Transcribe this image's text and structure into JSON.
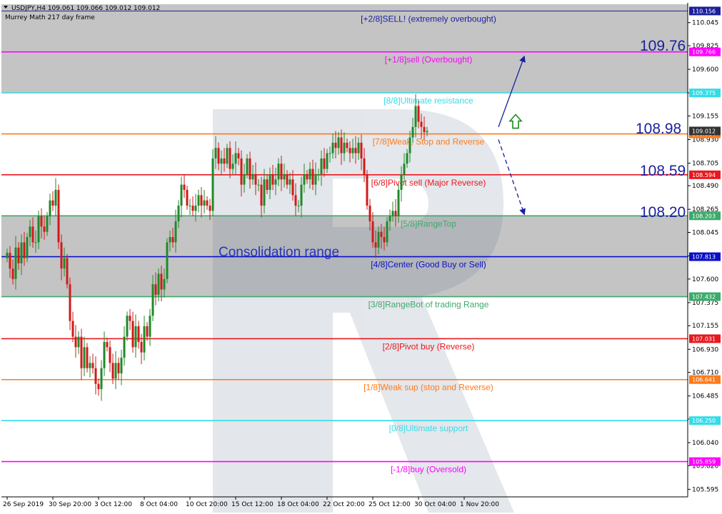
{
  "header": {
    "symbol_line": "USDJPY,H4  109.061 109.066 109.012 109.012",
    "subtitle": "Murrey Math 217 day frame"
  },
  "colors": {
    "magenta": "#ff00ff",
    "cyan": "#33dde8",
    "orange": "#ff7a1a",
    "red": "#e8181f",
    "green": "#3caa6b",
    "blue": "#0a10c8",
    "navy": "#1a1f9c",
    "zone": "#c4c4c4",
    "bull": "#1f8a2a",
    "bear": "#d11a1a",
    "arrow_green": "#1a8a1a"
  },
  "annotations": {
    "consolidation": "Consolidation range",
    "big_labels": [
      "109.76",
      "108.98",
      "108.59",
      "108.20"
    ]
  },
  "chart_data": {
    "type": "candlestick",
    "symbol": "USDJPY",
    "timeframe": "H4",
    "ylim": [
      105.55,
      110.22
    ],
    "y_ticks": [
      110.045,
      109.825,
      109.6,
      109.375,
      109.155,
      108.93,
      108.705,
      108.49,
      108.265,
      108.045,
      107.82,
      107.6,
      107.375,
      107.155,
      106.93,
      106.71,
      106.485,
      106.265,
      106.04,
      105.82,
      105.595
    ],
    "x_ticks": [
      {
        "label": "26 Sep 2019",
        "i": 0
      },
      {
        "label": "30 Sep 20:00",
        "i": 16
      },
      {
        "label": "3 Oct 12:00",
        "i": 32
      },
      {
        "label": "8 Oct 04:00",
        "i": 48
      },
      {
        "label": "10 Oct 20:00",
        "i": 64
      },
      {
        "label": "15 Oct 12:00",
        "i": 80
      },
      {
        "label": "18 Oct 04:00",
        "i": 96
      },
      {
        "label": "22 Oct 20:00",
        "i": 112
      },
      {
        "label": "25 Oct 12:00",
        "i": 128
      },
      {
        "label": "30 Oct 04:00",
        "i": 144
      },
      {
        "label": "1 Nov 20:00",
        "i": 160
      }
    ],
    "levels": [
      {
        "price": 110.156,
        "label": "[+2/8]SELL! (extremely overbought)",
        "tag": "110.156",
        "color": "navy"
      },
      {
        "price": 109.766,
        "label": "[+1/8]sell (Overbought)",
        "tag": "109.766",
        "color": "magenta"
      },
      {
        "price": 109.375,
        "label": "[8/8]Ultimate resistance",
        "tag": "109.375",
        "color": "cyan"
      },
      {
        "price": 108.984,
        "label": "[7/8]Weak, Stop and Reverse",
        "tag": "108.984",
        "color": "orange"
      },
      {
        "price": 108.594,
        "label": "[6/8]Pivot sell (Major Reverse)",
        "tag": "108.594",
        "color": "red"
      },
      {
        "price": 108.203,
        "label": "[5/8]RangeTop",
        "tag": "108.203",
        "color": "green"
      },
      {
        "price": 107.813,
        "label": "[4/8]Center (Good Buy or Sell)",
        "tag": "107.813",
        "color": "blue"
      },
      {
        "price": 107.432,
        "label": "[3/8]RangeBot of trading Range",
        "tag": "107.432",
        "color": "green"
      },
      {
        "price": 107.031,
        "label": "[2/8]Pivot buy (Reverse)",
        "tag": "107.031",
        "color": "red"
      },
      {
        "price": 106.641,
        "label": "[1/8]Weak sup (stop and Reverse)",
        "tag": "106.641",
        "color": "orange"
      },
      {
        "price": 106.25,
        "label": "[0/8]Ultimate support",
        "tag": "106.250",
        "color": "cyan"
      },
      {
        "price": 105.859,
        "label": "[-1/8]buy (Oversold)",
        "tag": "105.859",
        "color": "magenta"
      }
    ],
    "zones": [
      {
        "from": 109.375,
        "to": 110.22
      },
      {
        "from": 107.432,
        "to": 108.203
      }
    ],
    "current_price": 109.012,
    "projections": [
      {
        "from_i": 172,
        "from_p": 109.05,
        "to_i": 181,
        "to_p": 109.72,
        "style": "solid"
      },
      {
        "from_i": 172,
        "from_p": 108.93,
        "to_i": 181,
        "to_p": 108.22,
        "style": "dashed"
      }
    ],
    "up_arrow": {
      "i": 178,
      "p": 109.1
    },
    "closes": [
      107.85,
      107.7,
      107.6,
      107.9,
      107.75,
      107.95,
      107.8,
      108.0,
      108.1,
      107.95,
      107.95,
      108.2,
      108.1,
      108.05,
      108.2,
      108.35,
      108.3,
      108.45,
      107.95,
      107.7,
      107.8,
      107.55,
      107.2,
      107.05,
      106.95,
      107.05,
      106.75,
      106.95,
      106.75,
      106.8,
      106.75,
      106.6,
      106.55,
      106.75,
      107.0,
      106.95,
      106.8,
      106.65,
      106.8,
      106.7,
      106.85,
      107.05,
      107.25,
      107.2,
      106.95,
      107.15,
      107.0,
      106.9,
      107.15,
      107.05,
      107.25,
      107.55,
      107.45,
      107.65,
      107.5,
      107.6,
      107.95,
      108.0,
      107.95,
      108.15,
      108.3,
      108.5,
      108.45,
      108.3,
      108.3,
      108.25,
      108.3,
      108.4,
      108.3,
      108.35,
      108.3,
      108.25,
      108.75,
      108.85,
      108.7,
      108.75,
      108.7,
      108.85,
      108.65,
      108.7,
      108.8,
      108.75,
      108.5,
      108.6,
      108.75,
      108.55,
      108.6,
      108.5,
      108.5,
      108.3,
      108.55,
      108.45,
      108.6,
      108.5,
      108.55,
      108.7,
      108.55,
      108.6,
      108.5,
      108.55,
      108.4,
      108.3,
      108.3,
      108.5,
      108.6,
      108.55,
      108.65,
      108.5,
      108.6,
      108.6,
      108.75,
      108.65,
      108.8,
      108.8,
      108.9,
      108.85,
      108.95,
      108.8,
      108.9,
      108.85,
      108.8,
      108.85,
      108.8,
      108.9,
      108.75,
      108.6,
      108.3,
      108.15,
      107.95,
      107.9,
      108.05,
      108.0,
      107.95,
      108.15,
      108.2,
      108.25,
      108.2,
      108.45,
      108.6,
      108.7,
      108.8,
      108.95,
      109.05,
      109.25,
      109.1,
      109.05,
      109.0,
      109.012
    ]
  }
}
